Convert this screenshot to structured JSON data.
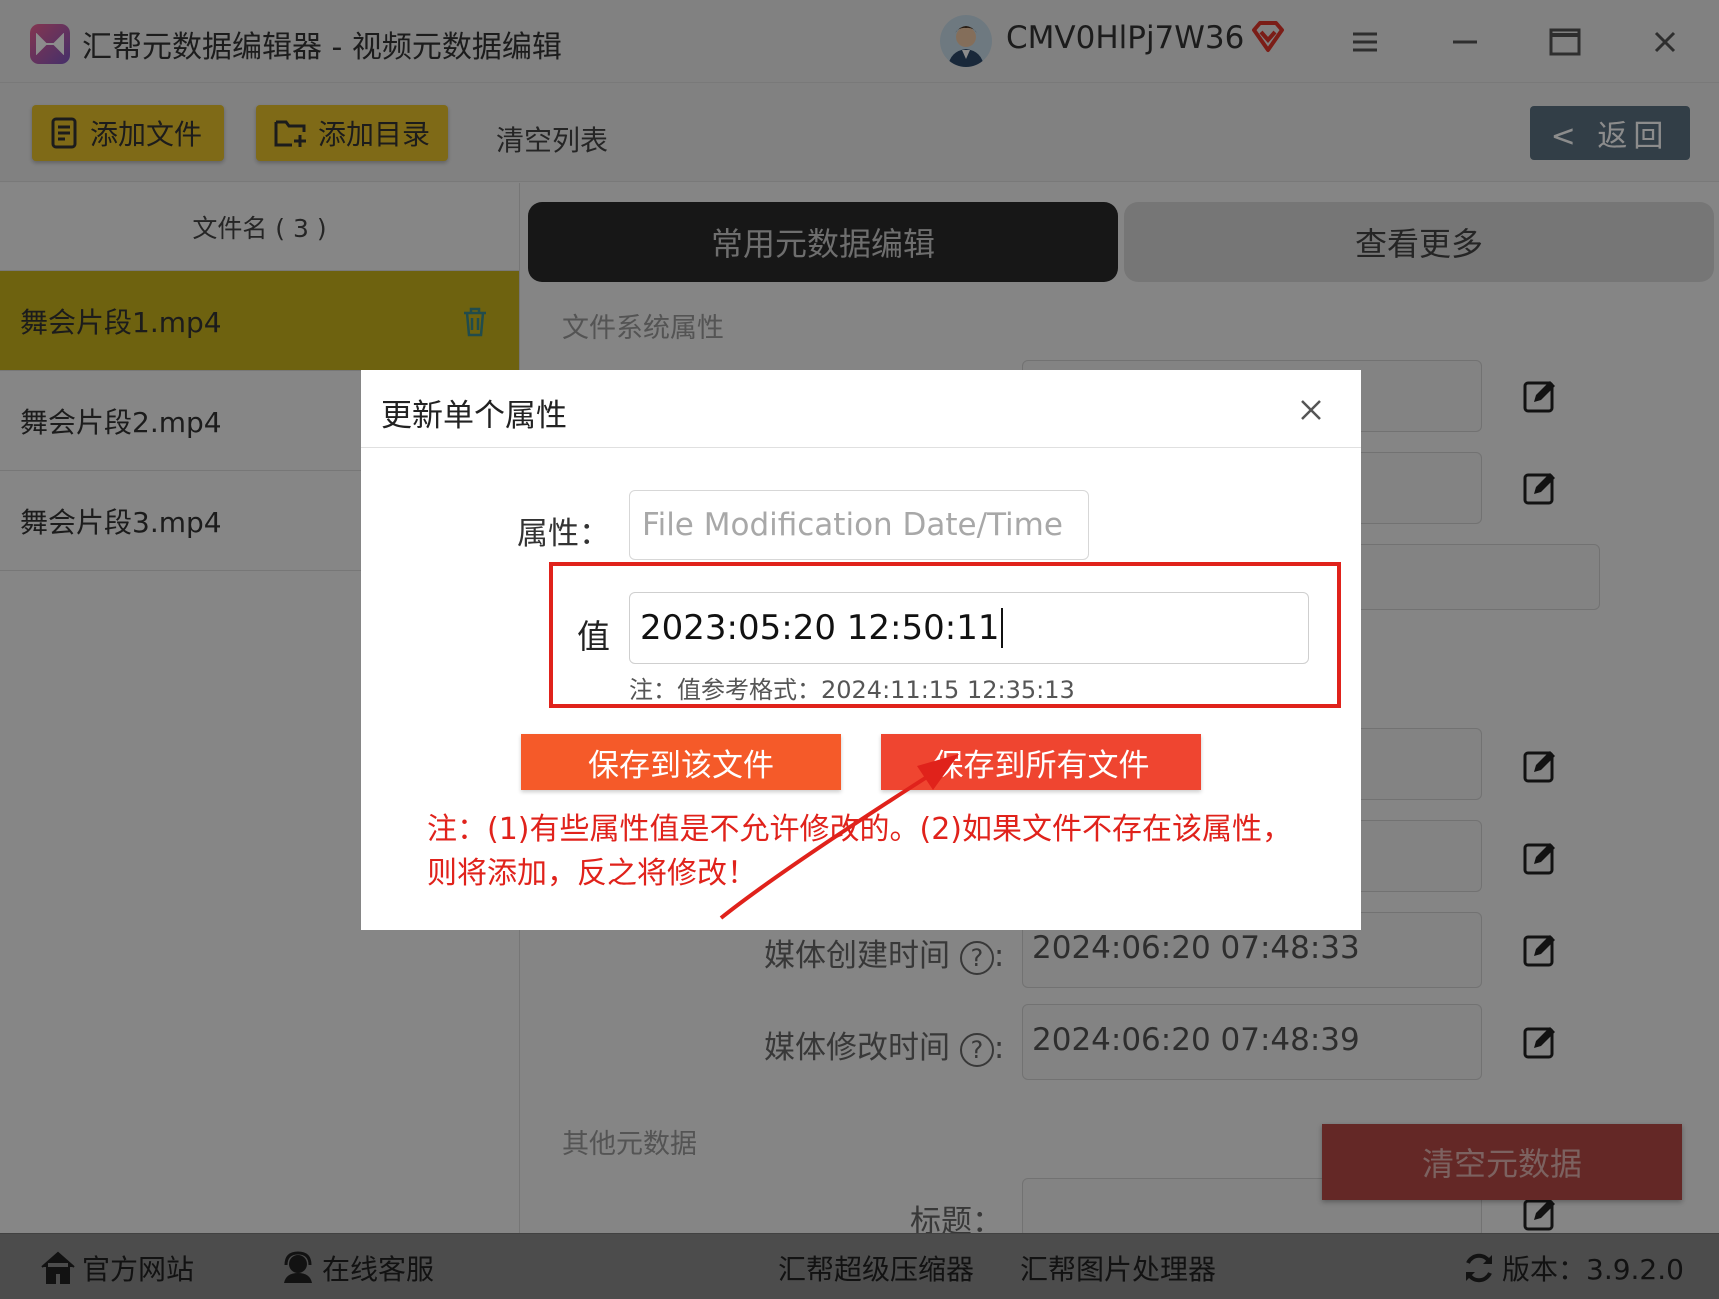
{
  "window": {
    "title": "汇帮元数据编辑器 - 视频元数据编辑",
    "username": "CMV0HlPj7W36",
    "icons": [
      "app-logo-icon",
      "avatar",
      "vip-diamond-icon",
      "menu-icon",
      "minimize-icon",
      "maximize-icon",
      "close-icon"
    ]
  },
  "toolbar": {
    "add_file": "添加文件",
    "add_dir": "添加目录",
    "clear_list": "清空列表",
    "back": "< 返回"
  },
  "sidebar": {
    "header": "文件名 ( 3 )",
    "files": [
      "舞会片段1.mp4",
      "舞会片段2.mp4",
      "舞会片段3.mp4"
    ]
  },
  "main": {
    "tabs": [
      "常用元数据编辑",
      "查看更多"
    ],
    "section_fs": "文件系统属性",
    "section_other": "其他元数据",
    "media_create_label": "媒体创建时间",
    "media_create_value": "2024:06:20 07:48:33",
    "media_modify_label": "媒体修改时间",
    "media_modify_value": "2024:06:20 07:48:39",
    "help_mark": "?",
    "colon": ":",
    "title_label": "标题：",
    "clear_metadata": "清空元数据"
  },
  "dialog": {
    "title": "更新单个属性",
    "property_label": "属性：",
    "property_value": "File Modification Date/Time",
    "value_label": "值",
    "value": "2023:05:20 12:50:11",
    "format_note": "注：值参考格式：2024:11:15 12:35:13",
    "save_this": "保存到该文件",
    "save_all": "保存到所有文件",
    "warning": "注：(1)有些属性值是不允许修改的。(2)如果文件不存在该属性，则将添加，反之将修改！",
    "highlight_color": "#e0221b"
  },
  "footer": {
    "website": "官方网站",
    "support": "在线客服",
    "compressor": "汇帮超级压缩器",
    "image_tool": "汇帮图片处理器",
    "version": "版本：3.9.2.0"
  },
  "colors": {
    "accent_yellow": "#e8c12a",
    "save_orange": "#f55a29",
    "save_red": "#ef4530"
  }
}
